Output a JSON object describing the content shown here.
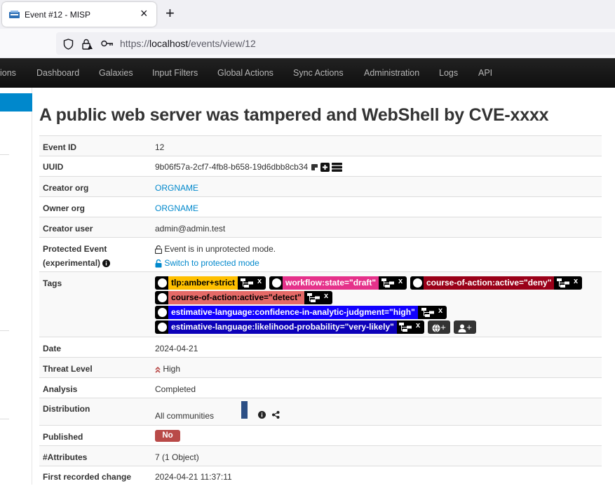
{
  "browser": {
    "tab_title": "Event #12 - MISP",
    "tab_close": "×",
    "new_tab": "+",
    "url_scheme": "https://",
    "url_host": "localhost",
    "url_path": "/events/view/12"
  },
  "navbar": {
    "items": [
      "ions",
      "Dashboard",
      "Galaxies",
      "Input Filters",
      "Global Actions",
      "Sync Actions",
      "Administration",
      "Logs",
      "API"
    ]
  },
  "event": {
    "title": "A public web server was tampered and WebShell by CVE-xxxx",
    "rows": {
      "event_id": {
        "label": "Event ID",
        "value": "12"
      },
      "uuid": {
        "label": "UUID",
        "value": "9b06f57a-2cf7-4fb8-b658-19d6dbb8cb34"
      },
      "creator_org": {
        "label": "Creator org",
        "value": "ORGNAME"
      },
      "owner_org": {
        "label": "Owner org",
        "value": "ORGNAME"
      },
      "creator_user": {
        "label": "Creator user",
        "value": "admin@admin.test"
      },
      "protected": {
        "label": "Protected Event",
        "label2": "(experimental)",
        "value": "Event is in unprotected mode.",
        "action": "Switch to protected mode"
      },
      "tags": {
        "label": "Tags"
      },
      "date": {
        "label": "Date",
        "value": "2024-04-21"
      },
      "threat_level": {
        "label": "Threat Level",
        "value": "High"
      },
      "analysis": {
        "label": "Analysis",
        "value": "Completed"
      },
      "distribution": {
        "label": "Distribution",
        "value": "All communities"
      },
      "published": {
        "label": "Published",
        "value": "No"
      },
      "attributes": {
        "label": "#Attributes",
        "value": "7 (1 Object)"
      },
      "first_change": {
        "label": "First recorded change",
        "value": "2024-04-21 11:37:11"
      }
    },
    "tags": [
      {
        "name": "tlp:amber+strict",
        "bg": "#FFC000",
        "fg": "#000000"
      },
      {
        "name": "workflow:state=\"draft\"",
        "bg": "#e5318a",
        "fg": "#ffffff"
      },
      {
        "name": "course-of-action:active=\"deny\"",
        "bg": "#9a0018",
        "fg": "#ffffff"
      },
      {
        "name": "course-of-action:active=\"detect\"",
        "bg": "#e46967",
        "fg": "#000000"
      },
      {
        "name": "estimative-language:confidence-in-analytic-judgment=\"high\"",
        "bg": "#1100ff",
        "fg": "#ffffff"
      },
      {
        "name": "estimative-language:likelihood-probability=\"very-likely\"",
        "bg": "#0c00b8",
        "fg": "#ffffff"
      }
    ],
    "tag_remove": "x",
    "tag_add_plus": "+"
  },
  "colors": {
    "link": "#0088cc",
    "navbar_bg": "#1a1a1a",
    "sidebar_active": "#0088cc",
    "threat_high": "#b94a48",
    "published_no": "#b94a48"
  }
}
